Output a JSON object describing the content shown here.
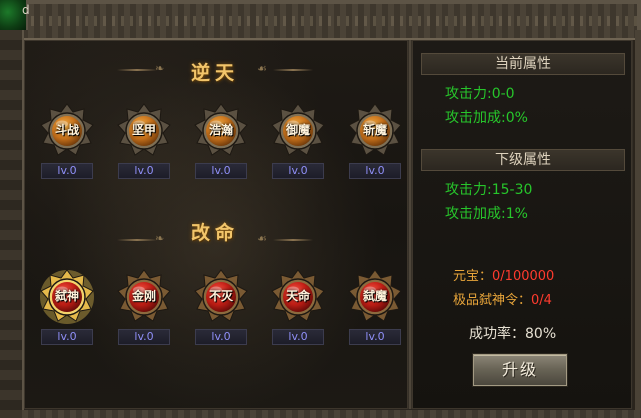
{
  "window": {
    "corner_letter": "d"
  },
  "sections": {
    "top": {
      "title": "逆天"
    },
    "bottom": {
      "title": "改命"
    }
  },
  "top_skills": [
    {
      "label": "斗战",
      "level": "lv.0",
      "icon": "gold-orb-emblem"
    },
    {
      "label": "坚甲",
      "level": "lv.0",
      "icon": "gold-orb-emblem"
    },
    {
      "label": "浩瀚",
      "level": "lv.0",
      "icon": "gold-orb-emblem"
    },
    {
      "label": "御魔",
      "level": "lv.0",
      "icon": "gold-orb-emblem"
    },
    {
      "label": "斩魔",
      "level": "lv.0",
      "icon": "gold-orb-emblem"
    }
  ],
  "bottom_skills": [
    {
      "label": "弑神",
      "level": "lv.0",
      "icon": "red-orb-emblem",
      "selected": true
    },
    {
      "label": "金刚",
      "level": "lv.0",
      "icon": "red-orb-emblem"
    },
    {
      "label": "不灭",
      "level": "lv.0",
      "icon": "red-orb-emblem"
    },
    {
      "label": "天命",
      "level": "lv.0",
      "icon": "red-orb-emblem"
    },
    {
      "label": "弑魔",
      "level": "lv.0",
      "icon": "red-orb-emblem"
    }
  ],
  "current_attributes": {
    "header": "当前属性",
    "attack": "攻击力:0-0",
    "attack_bonus": "攻击加成:0%"
  },
  "next_attributes": {
    "header": "下级属性",
    "attack": "攻击力:15-30",
    "attack_bonus": "攻击加成:1%"
  },
  "resources": {
    "yuanbao_label": "元宝：",
    "yuanbao_value": "0/100000",
    "token_label": "极品弑神令：",
    "token_value": "0/4"
  },
  "success_rate": "成功率：80%",
  "upgrade_button": "升级",
  "colors": {
    "gold_title": "#f2c56a",
    "green_stat": "#27c52b",
    "orange_label": "#e8a53a",
    "red_value": "#ff3b2e",
    "level_blue": "#8f8ff7"
  }
}
